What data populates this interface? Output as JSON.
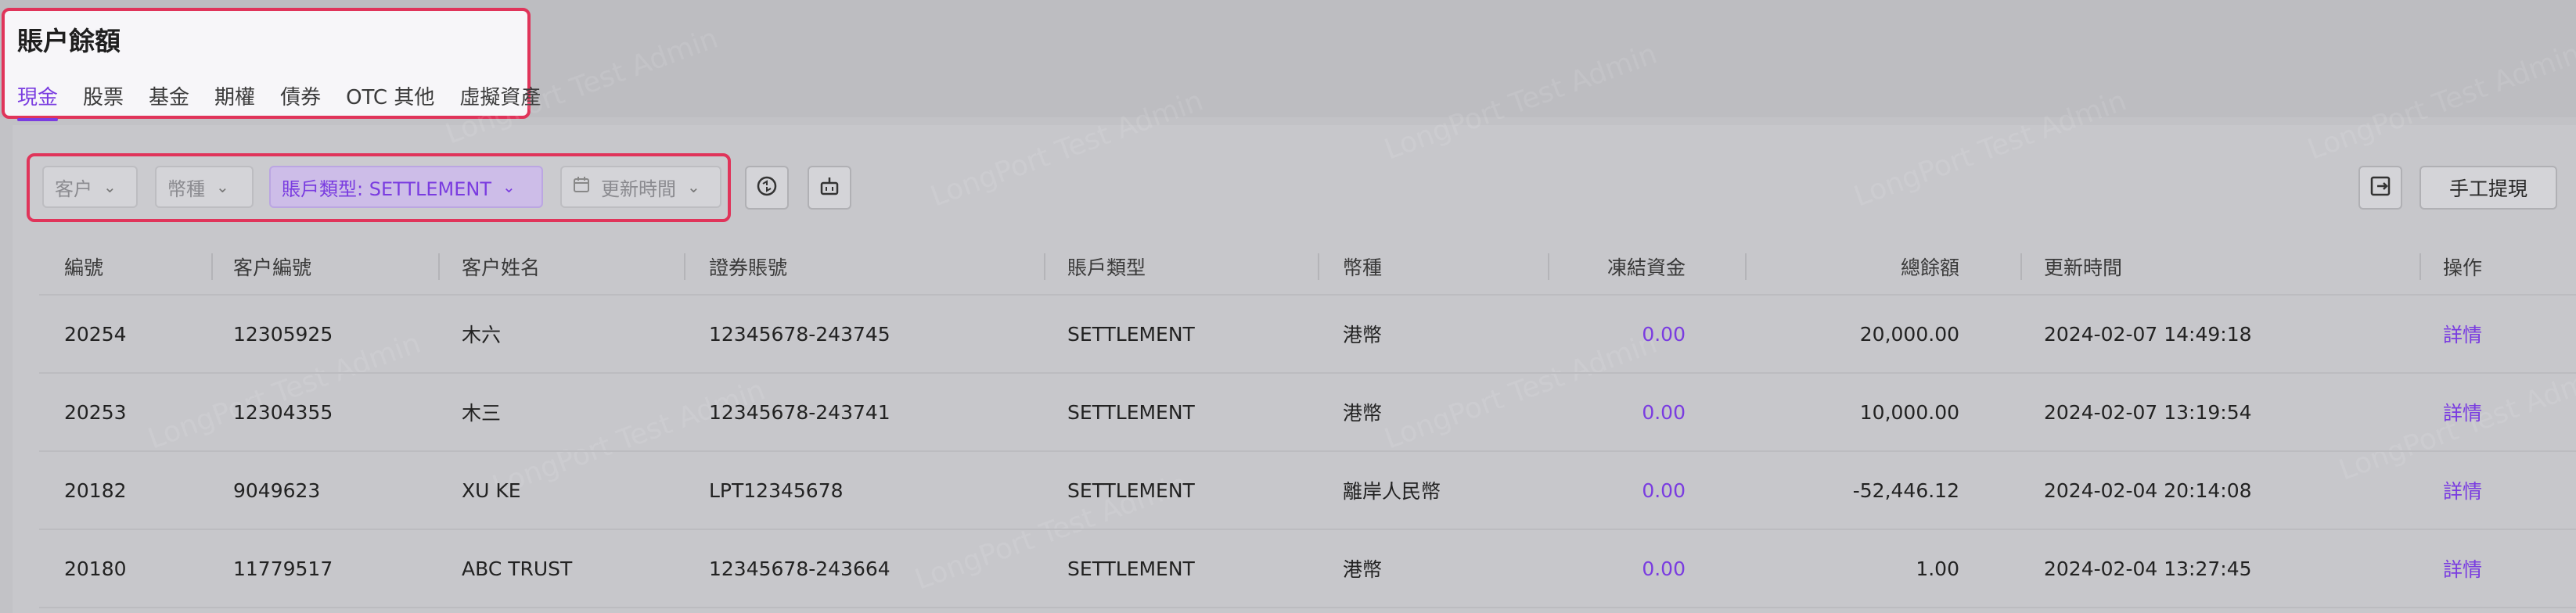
{
  "page": {
    "title": "賬户餘額",
    "tabs": [
      "現金",
      "股票",
      "基金",
      "期權",
      "債券",
      "OTC 其他",
      "虛擬資產"
    ],
    "active_tab": 0
  },
  "filters": {
    "customer": "客户",
    "currency": "幣種",
    "account_type": "賬戶類型: SETTLEMENT",
    "update_time": "更新時間"
  },
  "actions": {
    "manual_withdraw": "手工提現"
  },
  "watermark": "LongPort Test Admin",
  "table": {
    "columns": [
      "編號",
      "客户編號",
      "客户姓名",
      "證券賬號",
      "賬戶類型",
      "幣種",
      "凍結資金",
      "總餘額",
      "更新時間",
      "操作"
    ],
    "rows": [
      {
        "id": "20254",
        "customer_no": "12305925",
        "name": "木六",
        "securities_account": "12345678-243745",
        "account_type": "SETTLEMENT",
        "currency": "港幣",
        "frozen": "0.00",
        "balance": "20,000.00",
        "updated": "2024-02-07 14:49:18",
        "action": "詳情"
      },
      {
        "id": "20253",
        "customer_no": "12304355",
        "name": "木三",
        "securities_account": "12345678-243741",
        "account_type": "SETTLEMENT",
        "currency": "港幣",
        "frozen": "0.00",
        "balance": "10,000.00",
        "updated": "2024-02-07 13:19:54",
        "action": "詳情"
      },
      {
        "id": "20182",
        "customer_no": "9049623",
        "name": "XU KE",
        "securities_account": "LPT12345678",
        "account_type": "SETTLEMENT",
        "currency": "離岸人民幣",
        "frozen": "0.00",
        "balance": "-52,446.12",
        "updated": "2024-02-04 20:14:08",
        "action": "詳情"
      },
      {
        "id": "20180",
        "customer_no": "11779517",
        "name": "ABC TRUST",
        "securities_account": "12345678-243664",
        "account_type": "SETTLEMENT",
        "currency": "港幣",
        "frozen": "0.00",
        "balance": "1.00",
        "updated": "2024-02-04 13:27:45",
        "action": "詳情"
      }
    ]
  },
  "colors": {
    "accent": "#7a3ce0",
    "highlight_border": "#e0345a"
  }
}
